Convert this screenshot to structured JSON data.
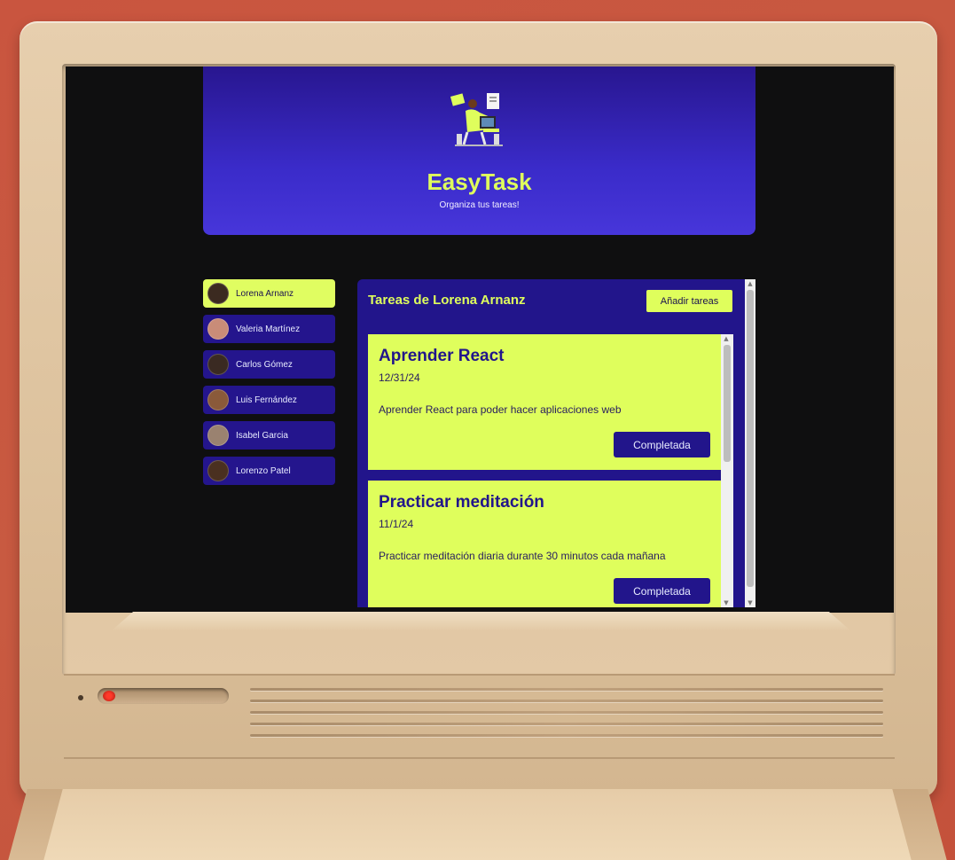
{
  "header": {
    "title": "EasyTask",
    "subtitle": "Organiza tus tareas!"
  },
  "users": [
    {
      "name": "Lorena Arnanz",
      "selected": true,
      "avatar_color": "#3b2a20"
    },
    {
      "name": "Valeria Martínez",
      "selected": false,
      "avatar_color": "#c98c78"
    },
    {
      "name": "Carlos Gómez",
      "selected": false,
      "avatar_color": "#3a2a22"
    },
    {
      "name": "Luis Fernández",
      "selected": false,
      "avatar_color": "#8a5a3a"
    },
    {
      "name": "Isabel Garcia",
      "selected": false,
      "avatar_color": "#9a8270"
    },
    {
      "name": "Lorenzo Patel",
      "selected": false,
      "avatar_color": "#4a3020"
    }
  ],
  "tasks_panel": {
    "title": "Tareas de Lorena Arnanz",
    "add_button": "Añadir tareas",
    "tasks": [
      {
        "title": "Aprender React",
        "date": "12/31/24",
        "description": "Aprender React para poder hacer aplicaciones web",
        "button": "Completada"
      },
      {
        "title": "Practicar meditación",
        "date": "11/1/24",
        "description": "Practicar meditación diaria durante 30 minutos cada mañana",
        "button": "Completada"
      }
    ]
  },
  "colors": {
    "accent": "#dffe5c",
    "primary": "#22158b",
    "background": "#c9553f"
  }
}
